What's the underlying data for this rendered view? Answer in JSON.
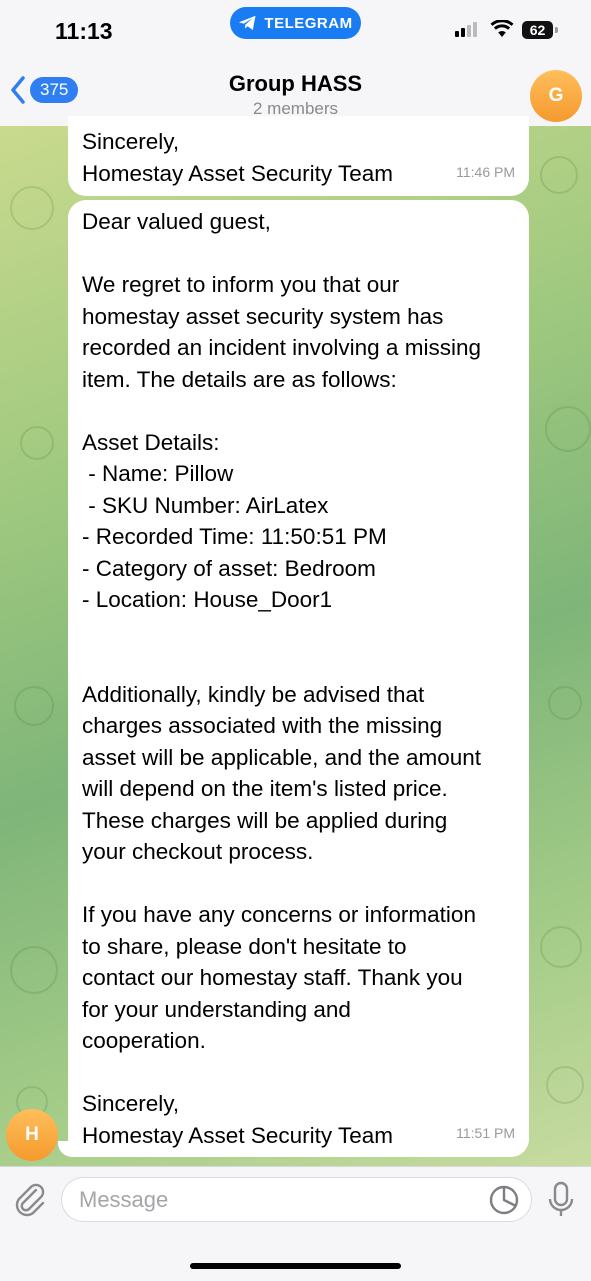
{
  "status_bar": {
    "time": "11:13",
    "app_pill": "TELEGRAM",
    "battery": "62"
  },
  "header": {
    "back_count": "375",
    "title": "Group HASS",
    "subtitle": "2 members",
    "avatar_letter": "G",
    "avatar_color": "#f7a33b"
  },
  "messages": [
    {
      "lines": [
        "Sincerely,",
        "Homestay Asset Security Team"
      ],
      "time": "11:46 PM"
    },
    {
      "lines": [
        "Dear valued guest,",
        "",
        "We regret to inform you that our",
        "homestay asset security system has",
        "recorded an incident involving a missing",
        "item. The details are as follows:",
        "",
        "Asset Details:",
        " - Name: Pillow",
        " - SKU Number: AirLatex",
        "- Recorded Time: 11:50:51 PM",
        "- Category of asset: Bedroom",
        "- Location: House_Door1",
        "",
        "",
        "Additionally, kindly be advised that",
        "charges associated with the missing",
        "asset will be applicable, and the amount",
        "will depend on the item's listed price.",
        "These charges will be applied during",
        "your checkout process.",
        "",
        "If you have any concerns or information",
        "to share, please don't hesitate to",
        "contact our homestay staff. Thank you",
        "for your understanding and",
        "cooperation.",
        "",
        "Sincerely,",
        "Homestay Asset Security Team"
      ],
      "time": "11:51 PM"
    }
  ],
  "sender_avatar_letter": "H",
  "input": {
    "placeholder": "Message"
  },
  "colors": {
    "accent": "#2f7ff2",
    "telegram_pill": "#1a7cf2",
    "avatar_orange": "#f7a33b"
  },
  "icons": [
    "telegram-icon",
    "signal-icon",
    "wifi-icon",
    "battery-icon",
    "chevron-left-icon",
    "paperclip-icon",
    "sticker-icon",
    "microphone-icon"
  ]
}
